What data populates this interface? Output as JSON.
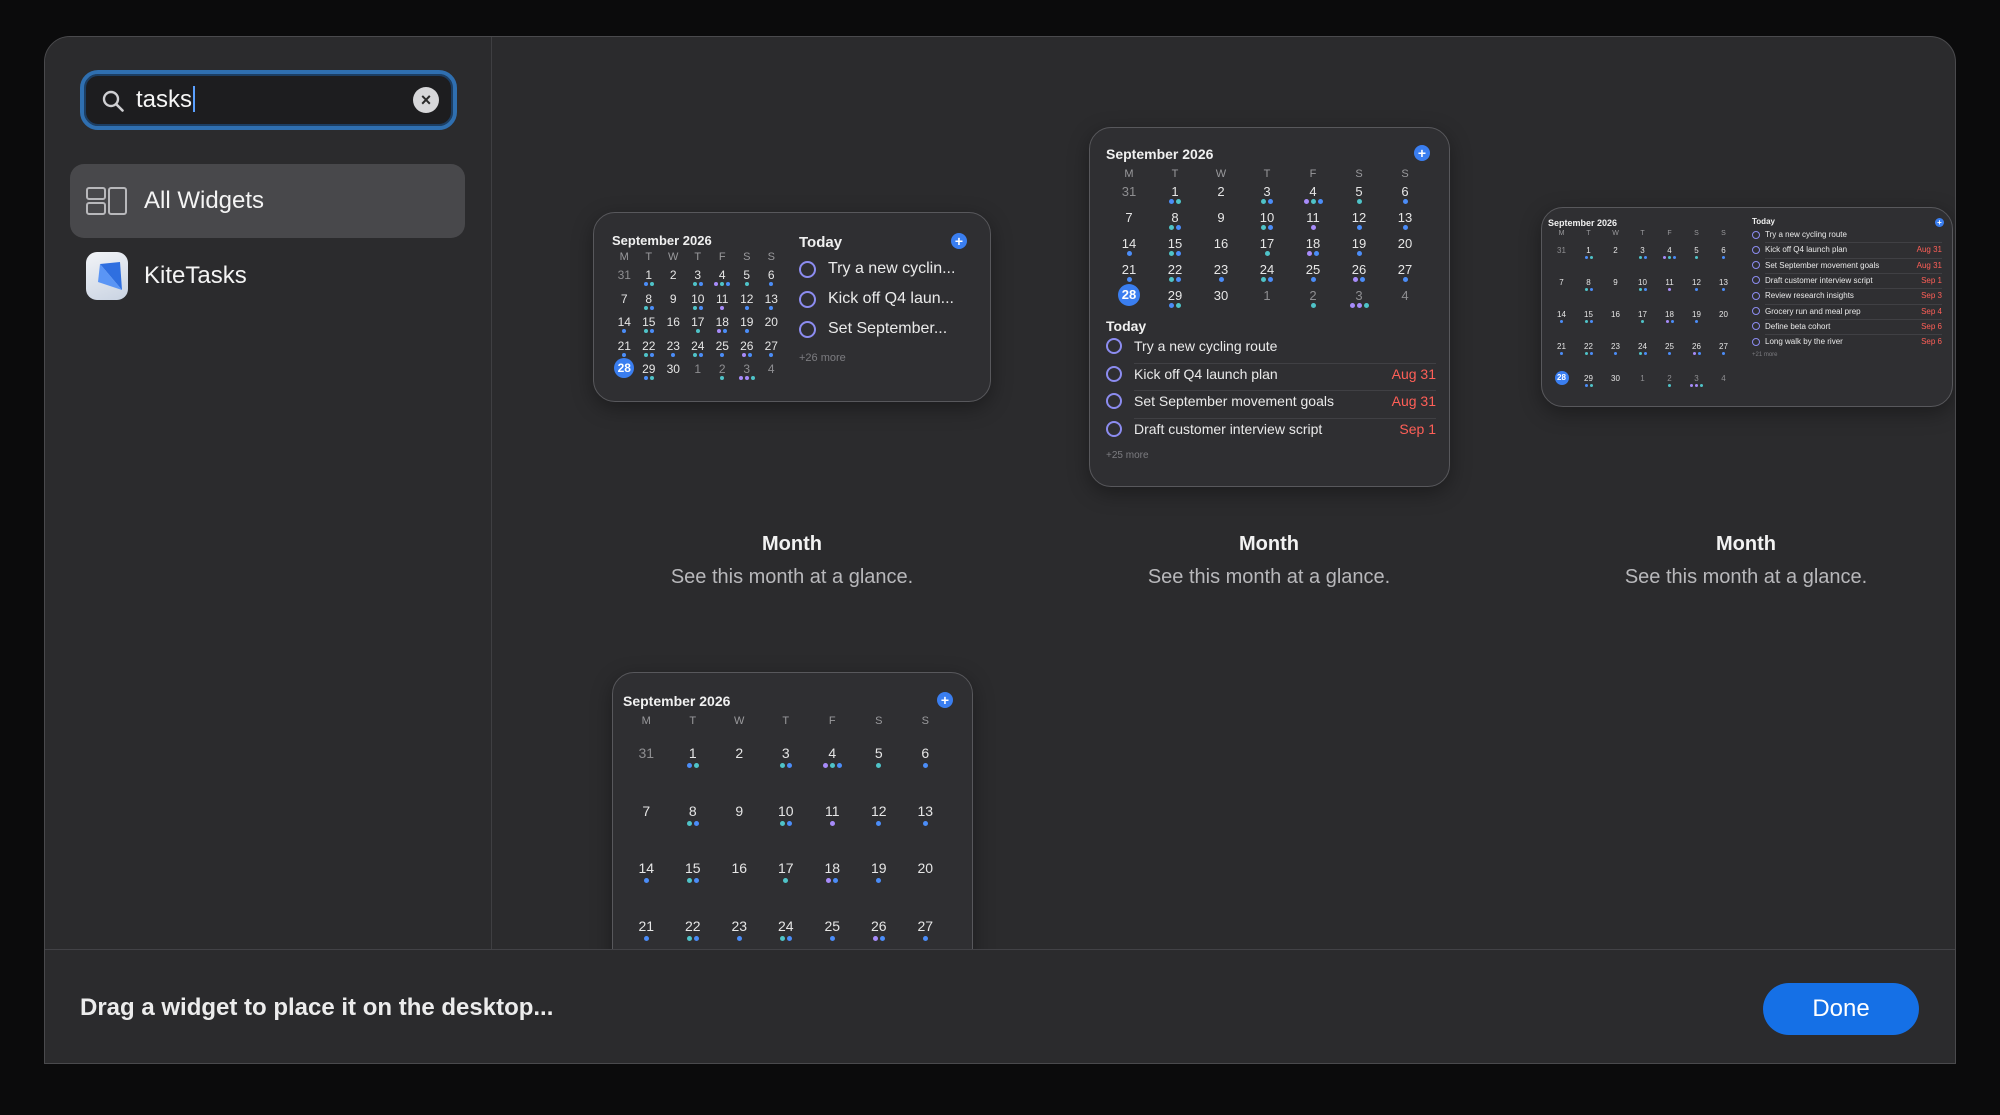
{
  "search": {
    "query": "tasks",
    "clear_icon": "close-circle-icon"
  },
  "sidebar": {
    "items": [
      {
        "label": "All Widgets",
        "icon": "widgets-icon",
        "active": true
      },
      {
        "label": "KiteTasks",
        "icon": "kitetasks-app-icon",
        "active": false
      }
    ]
  },
  "calendar": {
    "month": "September 2026",
    "weekdays": [
      "M",
      "T",
      "W",
      "T",
      "F",
      "S",
      "S"
    ],
    "weeks": [
      [
        "31",
        "1",
        "2",
        "3",
        "4",
        "5",
        "6"
      ],
      [
        "7",
        "8",
        "9",
        "10",
        "11",
        "12",
        "13"
      ],
      [
        "14",
        "15",
        "16",
        "17",
        "18",
        "19",
        "20"
      ],
      [
        "21",
        "22",
        "23",
        "24",
        "25",
        "26",
        "27"
      ],
      [
        "28",
        "29",
        "30",
        "1",
        "2",
        "3",
        "4"
      ]
    ],
    "today": "28",
    "colors": {
      "accent": "#3a7ef0",
      "dot_blue": "#4b8df8",
      "dot_teal": "#4fc3c8",
      "dot_purple": "#a78bfa"
    }
  },
  "widgets": [
    {
      "size": "medium",
      "todo_title": "Today",
      "todos": [
        {
          "text": "Try a new cyclin...",
          "due": ""
        },
        {
          "text": "Kick off Q4 laun...",
          "due": ""
        },
        {
          "text": "Set September...",
          "due": ""
        }
      ],
      "more": "+26 more",
      "caption": {
        "name": "Month",
        "desc": "See this month at a glance."
      }
    },
    {
      "size": "large",
      "todo_title": "Today",
      "todos": [
        {
          "text": "Try a new cycling route",
          "due": ""
        },
        {
          "text": "Kick off Q4 launch plan",
          "due": "Aug 31"
        },
        {
          "text": "Set September movement goals",
          "due": "Aug 31"
        },
        {
          "text": "Draft customer interview script",
          "due": "Sep 1"
        }
      ],
      "more": "+25 more",
      "caption": {
        "name": "Month",
        "desc": "See this month at a glance."
      }
    },
    {
      "size": "extra-large",
      "todo_title": "Today",
      "todos": [
        {
          "text": "Try a new cycling route",
          "due": ""
        },
        {
          "text": "Kick off Q4 launch plan",
          "due": "Aug 31"
        },
        {
          "text": "Set September movement goals",
          "due": "Aug 31"
        },
        {
          "text": "Draft customer interview script",
          "due": "Sep 1"
        },
        {
          "text": "Review research insights",
          "due": "Sep 3"
        },
        {
          "text": "Grocery run and meal prep",
          "due": "Sep 4"
        },
        {
          "text": "Define beta cohort",
          "due": "Sep 6"
        },
        {
          "text": "Long walk by the river",
          "due": "Sep 6"
        }
      ],
      "more": "+21 more",
      "caption": {
        "name": "Month",
        "desc": "See this month at a glance."
      }
    },
    {
      "size": "calendar-large",
      "caption": {
        "name": "",
        "desc": ""
      }
    }
  ],
  "footer": {
    "hint": "Drag a widget to place it on the desktop...",
    "done_label": "Done"
  }
}
